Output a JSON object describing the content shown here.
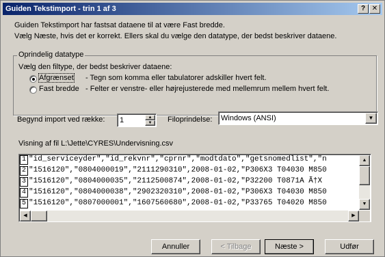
{
  "window": {
    "title": "Guiden Tekstimport - trin 1 af 3",
    "help_btn": "?",
    "close_btn": "✕"
  },
  "intro": {
    "line1": "Guiden Tekstimport har fastsat dataene til at være Fast bredde.",
    "line2": "Vælg Næste, hvis det er korrekt. Ellers skal du vælge den datatype, der bedst beskriver dataene."
  },
  "group": {
    "legend": "Oprindelig datatype",
    "prompt": "Vælg den filtype, der bedst beskriver dataene:",
    "options": [
      {
        "label": "Afgrænset",
        "desc": "- Tegn som komma eller tabulatorer adskiller hvert felt.",
        "selected": true
      },
      {
        "label": "Fast bredde",
        "desc": "- Felter er venstre- eller højrejusterede med mellemrum mellem hvert felt.",
        "selected": false
      }
    ]
  },
  "start_row": {
    "label": "Begynd import ved række:",
    "value": "1"
  },
  "origin": {
    "label": "Filoprindelse:",
    "value": "Windows (ANSI)"
  },
  "preview": {
    "label": "Visning af fil L:\\Jette\\CYRES\\Undervisning.csv",
    "rows": [
      {
        "num": "1",
        "text": "\"id_serviceyder\",\"id_rekvnr\",\"cprnr\",\"modtdato\",\"getsnomedlist\",\"n"
      },
      {
        "num": "2",
        "text": "\"1516120\",\"0804000019\",\"2111290310\",2008-01-02,\"P306X3 T04030 M850"
      },
      {
        "num": "3",
        "text": "\"1516120\",\"0804000035\",\"2112500874\",2008-01-02,\"P32200 T0871A Ã†X"
      },
      {
        "num": "4",
        "text": "\"1516120\",\"0804000038\",\"2902320310\",2008-01-02,\"P306X3 T04030 M850"
      },
      {
        "num": "5",
        "text": "\"1516120\",\"0807000001\",\"1607560680\",2008-01-02,\"P33765 T04020 M850"
      }
    ]
  },
  "buttons": {
    "cancel": "Annuller",
    "back": "< Tilbage",
    "next": "Næste >",
    "finish": "Udfør"
  }
}
